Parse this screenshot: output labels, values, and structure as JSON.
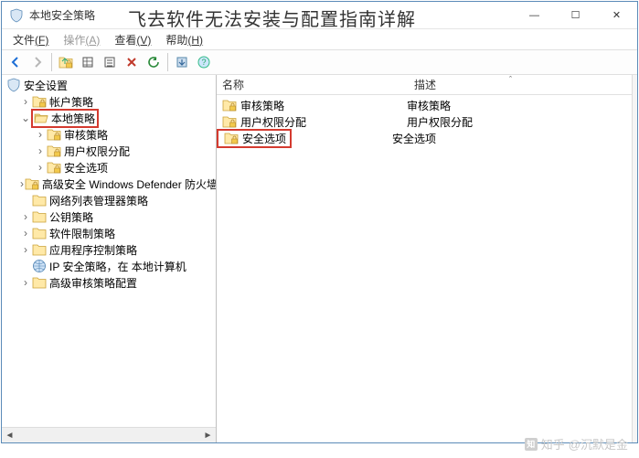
{
  "window": {
    "title": "本地安全策略",
    "overlay_title": "飞去软件无法安装与配置指南详解"
  },
  "win_buttons": {
    "min": "—",
    "max": "☐",
    "close": "✕"
  },
  "menu": {
    "file": {
      "label": "文件",
      "hotkey": "(F)"
    },
    "action": {
      "label": "操作",
      "hotkey": "(A)"
    },
    "view": {
      "label": "查看",
      "hotkey": "(V)"
    },
    "help": {
      "label": "帮助",
      "hotkey": "(H)"
    }
  },
  "toolbar_icons": {
    "back": "back-icon",
    "forward": "forward-icon",
    "up": "up-icon",
    "list_small": "list-small-icon",
    "list_large": "list-large-icon",
    "delete": "delete-icon",
    "refresh": "refresh-icon",
    "export": "export-icon",
    "help": "help-icon"
  },
  "tree": {
    "root": "安全设置",
    "items": [
      "帐户策略",
      "本地策略",
      "审核策略",
      "用户权限分配",
      "安全选项",
      "高级安全 Windows Defender 防火墙",
      "网络列表管理器策略",
      "公钥策略",
      "软件限制策略",
      "应用程序控制策略",
      "IP 安全策略，在 本地计算机",
      "高级审核策略配置"
    ]
  },
  "columns": {
    "name": "名称",
    "desc": "描述"
  },
  "list": {
    "rows": [
      {
        "name": "审核策略",
        "desc": "审核策略"
      },
      {
        "name": "用户权限分配",
        "desc": "用户权限分配"
      },
      {
        "name": "安全选项",
        "desc": "安全选项"
      }
    ]
  },
  "watermark": {
    "brand": "知乎",
    "author": "@沉默是金"
  },
  "colors": {
    "highlight_red": "#d43a2f",
    "border_blue": "#5b8bb8",
    "folder_fill": "#ffe9a8",
    "folder_stroke": "#caa23a"
  }
}
